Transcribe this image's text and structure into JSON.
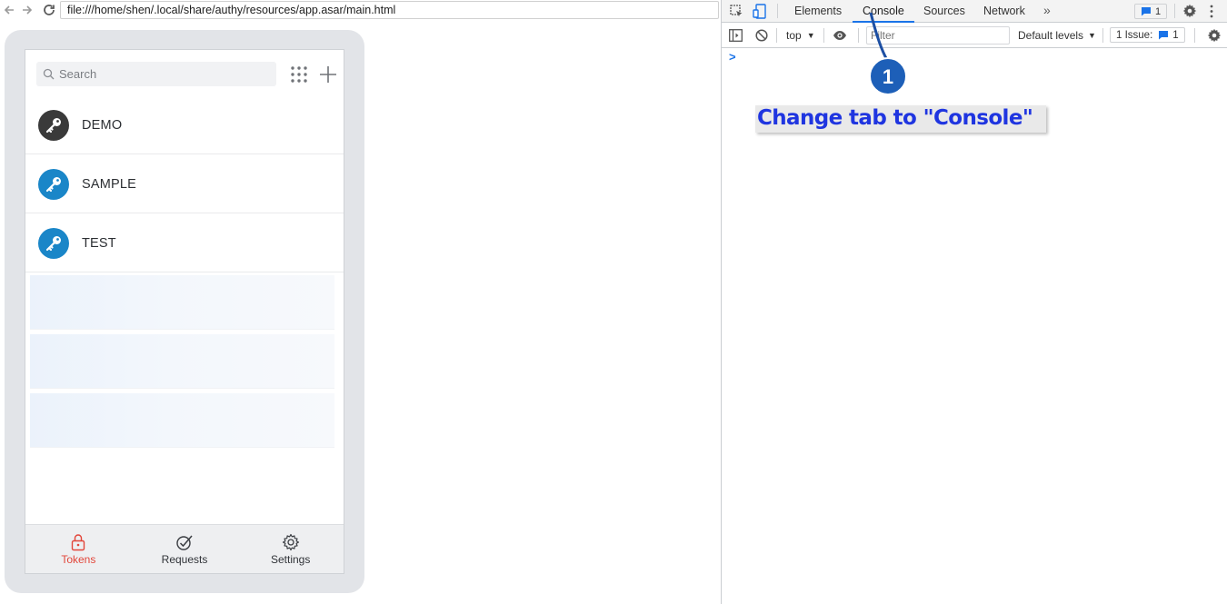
{
  "browser": {
    "url": "file:///home/shen/.local/share/authy/resources/app.asar/main.html"
  },
  "authy": {
    "search_placeholder": "Search",
    "tokens": [
      {
        "name": "DEMO",
        "color": "#3a3a3a"
      },
      {
        "name": "SAMPLE",
        "color": "#1a86c8"
      },
      {
        "name": "TEST",
        "color": "#1a86c8"
      }
    ],
    "bottom_tabs": [
      {
        "label": "Tokens",
        "icon": "lock-icon",
        "active": true
      },
      {
        "label": "Requests",
        "icon": "check-circle-icon",
        "active": false
      },
      {
        "label": "Settings",
        "icon": "gear-icon",
        "active": false
      }
    ],
    "accent_color": "#e2463a"
  },
  "devtools": {
    "tabs": [
      "Elements",
      "Console",
      "Sources",
      "Network"
    ],
    "active_tab": "Console",
    "messages_badge": "1",
    "context": "top",
    "filter_placeholder": "Filter",
    "levels": "Default levels",
    "issues_label": "1 Issue:",
    "issues_count": "1",
    "prompt": ">"
  },
  "annotation": {
    "step": "1",
    "text": "Change tab to \"Console\"",
    "color": "#1f35e0"
  }
}
